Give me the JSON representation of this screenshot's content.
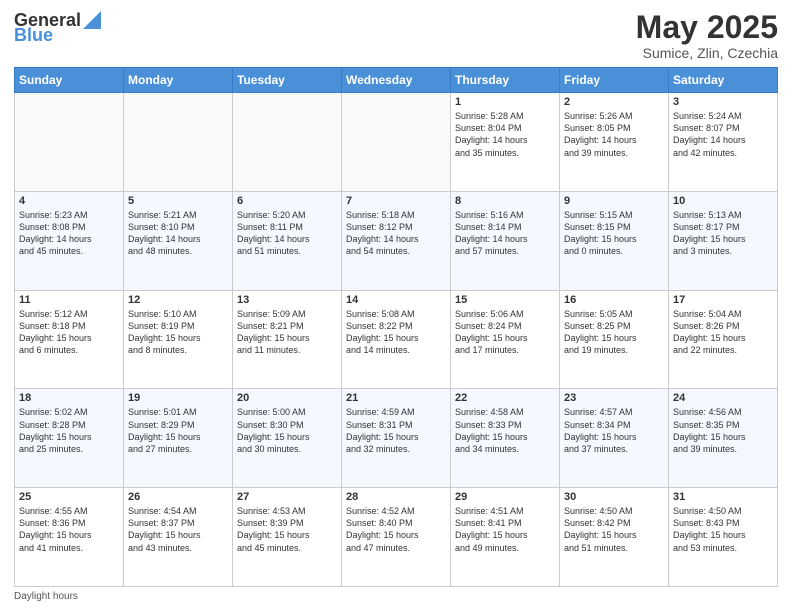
{
  "header": {
    "logo_general": "General",
    "logo_blue": "Blue",
    "title": "May 2025",
    "location": "Sumice, Zlin, Czechia"
  },
  "calendar": {
    "days_of_week": [
      "Sunday",
      "Monday",
      "Tuesday",
      "Wednesday",
      "Thursday",
      "Friday",
      "Saturday"
    ],
    "weeks": [
      [
        {
          "day": "",
          "content": ""
        },
        {
          "day": "",
          "content": ""
        },
        {
          "day": "",
          "content": ""
        },
        {
          "day": "",
          "content": ""
        },
        {
          "day": "1",
          "content": "Sunrise: 5:28 AM\nSunset: 8:04 PM\nDaylight: 14 hours\nand 35 minutes."
        },
        {
          "day": "2",
          "content": "Sunrise: 5:26 AM\nSunset: 8:05 PM\nDaylight: 14 hours\nand 39 minutes."
        },
        {
          "day": "3",
          "content": "Sunrise: 5:24 AM\nSunset: 8:07 PM\nDaylight: 14 hours\nand 42 minutes."
        }
      ],
      [
        {
          "day": "4",
          "content": "Sunrise: 5:23 AM\nSunset: 8:08 PM\nDaylight: 14 hours\nand 45 minutes."
        },
        {
          "day": "5",
          "content": "Sunrise: 5:21 AM\nSunset: 8:10 PM\nDaylight: 14 hours\nand 48 minutes."
        },
        {
          "day": "6",
          "content": "Sunrise: 5:20 AM\nSunset: 8:11 PM\nDaylight: 14 hours\nand 51 minutes."
        },
        {
          "day": "7",
          "content": "Sunrise: 5:18 AM\nSunset: 8:12 PM\nDaylight: 14 hours\nand 54 minutes."
        },
        {
          "day": "8",
          "content": "Sunrise: 5:16 AM\nSunset: 8:14 PM\nDaylight: 14 hours\nand 57 minutes."
        },
        {
          "day": "9",
          "content": "Sunrise: 5:15 AM\nSunset: 8:15 PM\nDaylight: 15 hours\nand 0 minutes."
        },
        {
          "day": "10",
          "content": "Sunrise: 5:13 AM\nSunset: 8:17 PM\nDaylight: 15 hours\nand 3 minutes."
        }
      ],
      [
        {
          "day": "11",
          "content": "Sunrise: 5:12 AM\nSunset: 8:18 PM\nDaylight: 15 hours\nand 6 minutes."
        },
        {
          "day": "12",
          "content": "Sunrise: 5:10 AM\nSunset: 8:19 PM\nDaylight: 15 hours\nand 8 minutes."
        },
        {
          "day": "13",
          "content": "Sunrise: 5:09 AM\nSunset: 8:21 PM\nDaylight: 15 hours\nand 11 minutes."
        },
        {
          "day": "14",
          "content": "Sunrise: 5:08 AM\nSunset: 8:22 PM\nDaylight: 15 hours\nand 14 minutes."
        },
        {
          "day": "15",
          "content": "Sunrise: 5:06 AM\nSunset: 8:24 PM\nDaylight: 15 hours\nand 17 minutes."
        },
        {
          "day": "16",
          "content": "Sunrise: 5:05 AM\nSunset: 8:25 PM\nDaylight: 15 hours\nand 19 minutes."
        },
        {
          "day": "17",
          "content": "Sunrise: 5:04 AM\nSunset: 8:26 PM\nDaylight: 15 hours\nand 22 minutes."
        }
      ],
      [
        {
          "day": "18",
          "content": "Sunrise: 5:02 AM\nSunset: 8:28 PM\nDaylight: 15 hours\nand 25 minutes."
        },
        {
          "day": "19",
          "content": "Sunrise: 5:01 AM\nSunset: 8:29 PM\nDaylight: 15 hours\nand 27 minutes."
        },
        {
          "day": "20",
          "content": "Sunrise: 5:00 AM\nSunset: 8:30 PM\nDaylight: 15 hours\nand 30 minutes."
        },
        {
          "day": "21",
          "content": "Sunrise: 4:59 AM\nSunset: 8:31 PM\nDaylight: 15 hours\nand 32 minutes."
        },
        {
          "day": "22",
          "content": "Sunrise: 4:58 AM\nSunset: 8:33 PM\nDaylight: 15 hours\nand 34 minutes."
        },
        {
          "day": "23",
          "content": "Sunrise: 4:57 AM\nSunset: 8:34 PM\nDaylight: 15 hours\nand 37 minutes."
        },
        {
          "day": "24",
          "content": "Sunrise: 4:56 AM\nSunset: 8:35 PM\nDaylight: 15 hours\nand 39 minutes."
        }
      ],
      [
        {
          "day": "25",
          "content": "Sunrise: 4:55 AM\nSunset: 8:36 PM\nDaylight: 15 hours\nand 41 minutes."
        },
        {
          "day": "26",
          "content": "Sunrise: 4:54 AM\nSunset: 8:37 PM\nDaylight: 15 hours\nand 43 minutes."
        },
        {
          "day": "27",
          "content": "Sunrise: 4:53 AM\nSunset: 8:39 PM\nDaylight: 15 hours\nand 45 minutes."
        },
        {
          "day": "28",
          "content": "Sunrise: 4:52 AM\nSunset: 8:40 PM\nDaylight: 15 hours\nand 47 minutes."
        },
        {
          "day": "29",
          "content": "Sunrise: 4:51 AM\nSunset: 8:41 PM\nDaylight: 15 hours\nand 49 minutes."
        },
        {
          "day": "30",
          "content": "Sunrise: 4:50 AM\nSunset: 8:42 PM\nDaylight: 15 hours\nand 51 minutes."
        },
        {
          "day": "31",
          "content": "Sunrise: 4:50 AM\nSunset: 8:43 PM\nDaylight: 15 hours\nand 53 minutes."
        }
      ]
    ]
  },
  "footer": {
    "note": "Daylight hours"
  }
}
